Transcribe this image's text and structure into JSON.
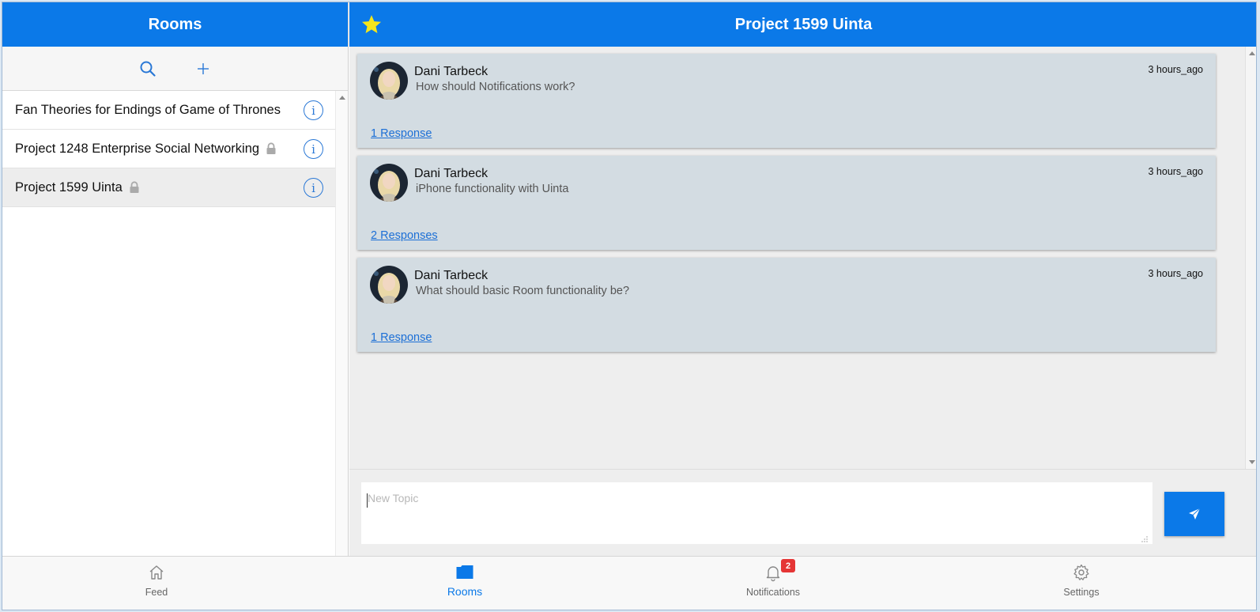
{
  "left": {
    "title": "Rooms",
    "rooms": [
      {
        "name": "Fan Theories for Endings of Game of Thrones",
        "locked": false,
        "selected": false
      },
      {
        "name": "Project 1248 Enterprise Social Networking",
        "locked": true,
        "selected": false
      },
      {
        "name": "Project 1599 Uinta",
        "locked": true,
        "selected": true
      }
    ]
  },
  "right": {
    "title": "Project 1599 Uinta",
    "topics": [
      {
        "author": "Dani Tarbeck",
        "text": "How should Notifications work?",
        "time": "3 hours_ago",
        "responses": "1 Response"
      },
      {
        "author": "Dani Tarbeck",
        "text": "iPhone functionality with Uinta",
        "time": "3 hours_ago",
        "responses": "2 Responses"
      },
      {
        "author": "Dani Tarbeck",
        "text": "What should basic Room functionality be?",
        "time": "3 hours_ago",
        "responses": "1 Response"
      }
    ],
    "composer": {
      "placeholder": "New Topic"
    }
  },
  "nav": {
    "items": [
      {
        "label": "Feed",
        "icon": "home-icon"
      },
      {
        "label": "Rooms",
        "icon": "rooms-icon"
      },
      {
        "label": "Notifications",
        "icon": "bell-icon",
        "badge": "2"
      },
      {
        "label": "Settings",
        "icon": "gear-icon"
      }
    ],
    "active": "Rooms"
  },
  "colors": {
    "primary": "#0b79e8",
    "card": "#d3dce2",
    "badge": "#e53535",
    "star": "#f5e61a"
  }
}
